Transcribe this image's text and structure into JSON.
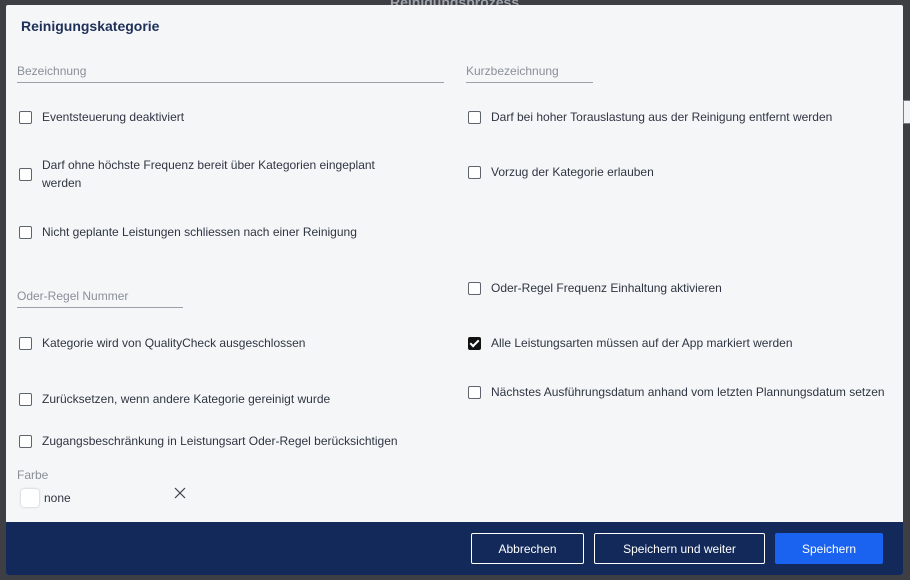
{
  "backdrop": {
    "title": "Reinigungsprozess"
  },
  "dialog": {
    "title": "Reinigungskategorie",
    "fields": {
      "bezeichnung": {
        "label": "Bezeichnung",
        "value": ""
      },
      "kurzbezeichnung": {
        "label": "Kurzbezeichnung",
        "value": ""
      },
      "oder_regel_nummer": {
        "label": "Oder-Regel Nummer",
        "value": ""
      }
    },
    "checkboxes": {
      "eventsteuerung": {
        "label": "Eventsteuerung deaktiviert",
        "checked": false
      },
      "torauslastung": {
        "label": "Darf bei hoher Torauslastung aus der Reinigung entfernt werden",
        "checked": false
      },
      "hoechste_frequenz": {
        "label": "Darf ohne höchste Frequenz bereit über Kategorien eingeplant werden",
        "checked": false
      },
      "vorzug": {
        "label": "Vorzug der Kategorie erlauben",
        "checked": false
      },
      "nicht_geplante": {
        "label": "Nicht geplante Leistungen schliessen nach einer Reinigung",
        "checked": false
      },
      "oder_regel_frequenz": {
        "label": "Oder-Regel Frequenz Einhaltung aktivieren",
        "checked": false
      },
      "qualitycheck": {
        "label": "Kategorie wird von QualityCheck ausgeschlossen",
        "checked": false
      },
      "leistungsarten_app": {
        "label": "Alle Leistungsarten müssen auf der App markiert werden",
        "checked": true
      },
      "zuruecksetzen": {
        "label": "Zurücksetzen, wenn andere Kategorie gereinigt wurde",
        "checked": false
      },
      "naechstes_datum": {
        "label": "Nächstes Ausführungsdatum anhand vom letzten Plannungsdatum setzen",
        "checked": false
      },
      "zugangsbeschraenkung": {
        "label": "Zugangsbeschränkung in Leistungsart Oder-Regel berücksichtigen",
        "checked": false
      }
    },
    "color": {
      "label": "Farbe",
      "value": "none",
      "swatch": "#ffffff"
    },
    "footer": {
      "cancel_label": "Abbrechen",
      "save_continue_label": "Speichern und weiter",
      "save_label": "Speichern"
    }
  },
  "colors": {
    "footer_bg": "#13295a",
    "primary": "#1a62f0",
    "title": "#1e2f58"
  }
}
